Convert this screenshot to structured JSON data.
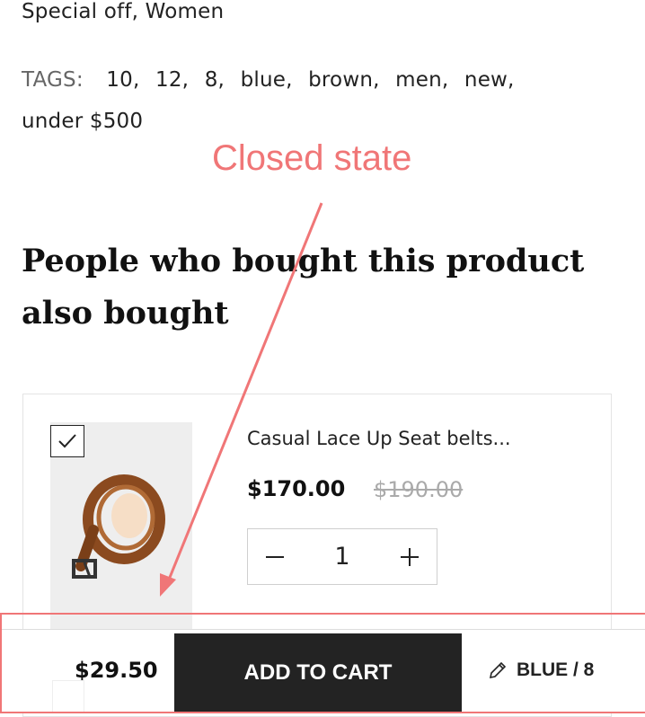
{
  "product_meta": {
    "categories": "Special off,  Women",
    "tags_label": "TAGS:",
    "tags": [
      "10,",
      "12,",
      "8,",
      "blue,",
      "brown,",
      "men,",
      "new,",
      "under $500"
    ]
  },
  "annotation": {
    "label": "Closed state",
    "color": "#f07677"
  },
  "section": {
    "heading": "People who bought this product also bought"
  },
  "related_product": {
    "name": "Casual Lace Up Seat belts...",
    "price": "$170.00",
    "old_price": "$190.00",
    "quantity": "1",
    "qty_minus_icon": "minus-icon",
    "qty_plus_icon": "plus-icon",
    "selected": true
  },
  "sticky_bar": {
    "price": "$29.50",
    "add_to_cart_label": "ADD TO CART",
    "variant_label": "BLUE / 8",
    "variant_icon": "pencil-icon",
    "button_color": "#232323"
  }
}
